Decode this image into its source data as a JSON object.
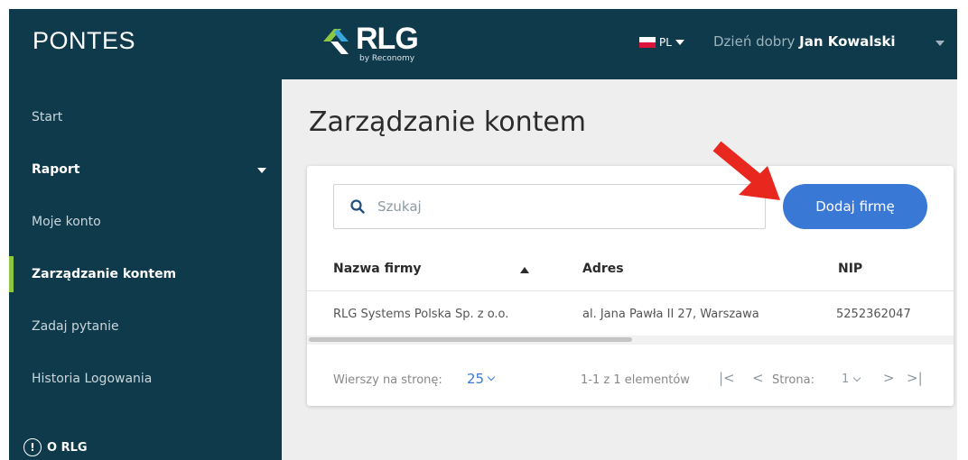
{
  "header": {
    "brand": "PONTES",
    "logo_text": "RLG",
    "logo_subtitle": "by Reconomy",
    "language": "PL",
    "greeting": "Dzień dobry",
    "user_name": "Jan Kowalski"
  },
  "sidebar": {
    "items": [
      {
        "label": "Start"
      },
      {
        "label": "Raport"
      },
      {
        "label": "Moje konto"
      },
      {
        "label": "Zarządzanie kontem"
      },
      {
        "label": "Zadaj pytanie"
      },
      {
        "label": "Historia Logowania"
      }
    ],
    "about_label": "O RLG"
  },
  "main": {
    "title": "Zarządzanie kontem",
    "search_placeholder": "Szukaj",
    "add_button": "Dodaj firmę",
    "table": {
      "columns": [
        "Nazwa firmy",
        "Adres",
        "NIP"
      ],
      "rows": [
        [
          "RLG Systems Polska Sp. z o.o.",
          "al. Jana Pawła II 27, Warszawa",
          "5252362047"
        ]
      ]
    },
    "footer": {
      "rows_per_page_label": "Wierszy na stronę:",
      "rows_per_page": "25",
      "range": "1-1 z 1 elementów",
      "page_label": "Strona:",
      "page": "1"
    }
  },
  "colors": {
    "sidebar": "#0f3a4c",
    "accent": "#3a78d6",
    "active_marker": "#8dc63f",
    "annotation_arrow": "#e8281e"
  },
  "icons": [
    "logo-icon",
    "flag-icon",
    "caret-down-icon",
    "search-icon",
    "sort-asc-icon",
    "info-icon",
    "first-page-icon",
    "prev-page-icon",
    "next-page-icon",
    "last-page-icon",
    "chevron-down-icon",
    "annotation-arrow-icon"
  ]
}
